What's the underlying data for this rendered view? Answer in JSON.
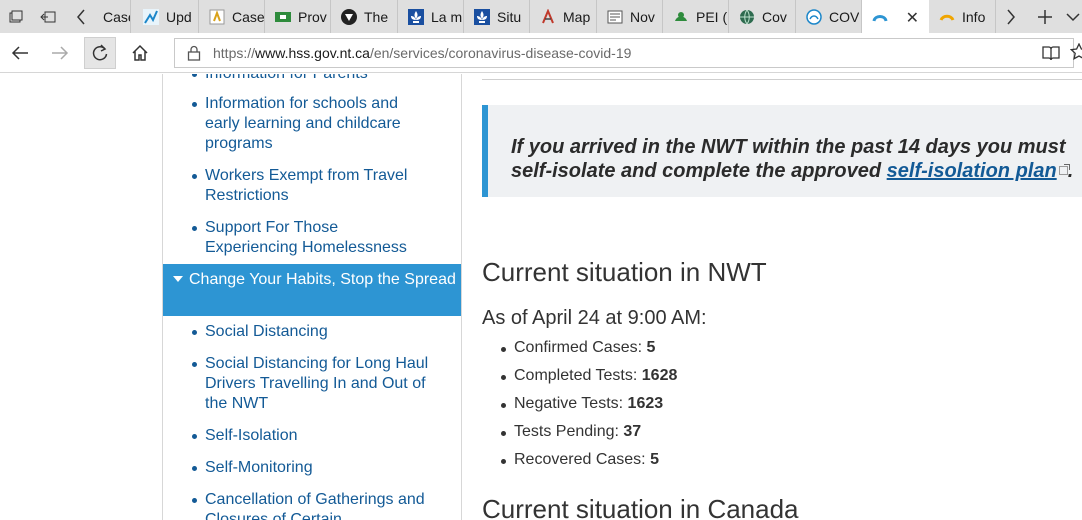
{
  "browser": {
    "tabs": [
      {
        "label": "Case",
        "icon": "case-icon",
        "icon_color": "#d9a21b"
      },
      {
        "label": "Upd",
        "icon": "chart-icon",
        "icon_color": "#1b86c9"
      },
      {
        "label": "Case",
        "icon": "case-icon",
        "icon_color": "#d9a21b"
      },
      {
        "label": "Prov",
        "icon": "flag-icon",
        "icon_color": "#2e8b3c"
      },
      {
        "label": "The",
        "icon": "shield-icon",
        "icon_color": "#222222"
      },
      {
        "label": "La m",
        "icon": "fleur-de-lis-icon",
        "icon_color": "#1a4fa0"
      },
      {
        "label": "Situ",
        "icon": "fleur-de-lis-icon",
        "icon_color": "#1a4fa0"
      },
      {
        "label": "Map",
        "icon": "map-icon",
        "icon_color": "#c0392b"
      },
      {
        "label": "Nov",
        "icon": "news-icon",
        "icon_color": "#555555"
      },
      {
        "label": "PEI (",
        "icon": "pei-icon",
        "icon_color": "#2e8b3c"
      },
      {
        "label": "Cov",
        "icon": "globe-icon",
        "icon_color": "#2e6b4f"
      },
      {
        "label": "COV",
        "icon": "covid-icon",
        "icon_color": "#1b86c9"
      },
      {
        "label": "",
        "icon": "nwt-icon",
        "icon_color": "#2d95d3",
        "active": true
      },
      {
        "label": "Info",
        "icon": "sun-icon",
        "icon_color": "#f0a500"
      }
    ],
    "url_prefix": "https://",
    "url_host": "www.hss.gov.nt.ca",
    "url_path": "/en/services/coronavirus-disease-covid-19"
  },
  "sidebar": {
    "items": [
      {
        "label": "Information for Parents"
      },
      {
        "label": "Information for schools and early learning and childcare programs"
      },
      {
        "label": "Workers Exempt from Travel Restrictions"
      },
      {
        "label": "Support For Those Experiencing Homelessness"
      },
      {
        "label": "Social Distancing"
      },
      {
        "label": "Social Distancing for Long Haul Drivers Travelling In and Out of the NWT"
      },
      {
        "label": "Self-Isolation"
      },
      {
        "label": "Self-Monitoring"
      },
      {
        "label": "Cancellation of Gatherings and Closures of Certain"
      }
    ],
    "active_section": "Change Your Habits, Stop the Spread",
    "accent_color": "#2d95d3"
  },
  "main": {
    "alert_text": "If you arrived in the NWT within the past 14 days you must",
    "alert_text_line2": "self-isolate and complete the approved ",
    "alert_link": "self-isolation plan",
    "alert_end": ".",
    "heading_nwt": "Current situation in NWT",
    "as_of": "As of April 24 at 9:00 AM:",
    "stats": [
      {
        "label": "Confirmed Cases: ",
        "value": "5"
      },
      {
        "label": "Completed Tests: ",
        "value": "1628"
      },
      {
        "label": "Negative Tests: ",
        "value": "1623"
      },
      {
        "label": "Tests Pending: ",
        "value": "37"
      },
      {
        "label": "Recovered Cases: ",
        "value": "5"
      }
    ],
    "heading_canada": "Current situation in Canada"
  }
}
